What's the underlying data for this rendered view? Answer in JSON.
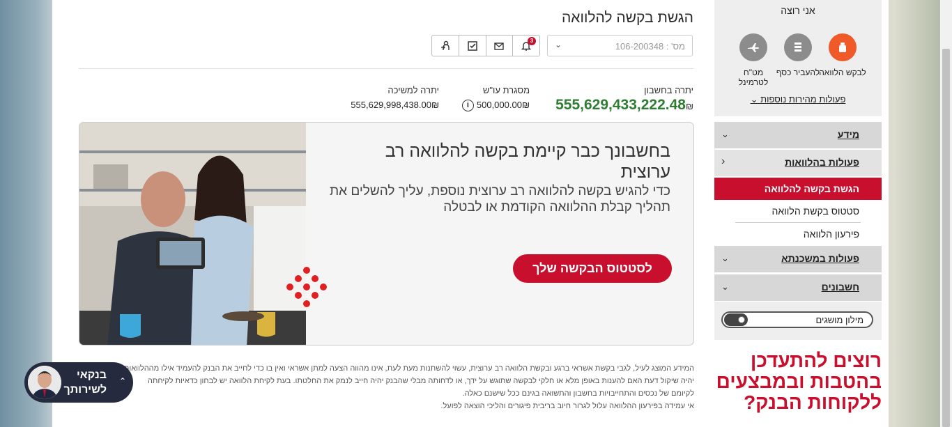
{
  "page": {
    "title": "הגשת בקשה להלוואה",
    "account_select": {
      "value": "מס' : 106-200348"
    },
    "notifications_count": "3"
  },
  "balances": {
    "account": {
      "label": "יתרה בחשבון",
      "value": "555,629,433,222.48",
      "currency": "₪"
    },
    "credit": {
      "label": "מסגרת עו\"ש",
      "value": "500,000.00",
      "currency": "₪",
      "info": "i"
    },
    "withdraw": {
      "label": "יתרה למשיכה",
      "value": "555,629,998,438.00",
      "currency": "₪"
    }
  },
  "card": {
    "heading": "בחשבונך כבר קיימת בקשה להלוואה רב ערוצית",
    "body": "כדי להגיש בקשה להלוואה רב ערוצית נוספת, עליך להשלים את תהליך קבלת ההלוואה הקודמת או לבטלה",
    "cta": "לסטטוס הבקשה שלך"
  },
  "disclaimer": [
    "המידע המוצג לעיל, לגבי בקשת אשראי ברגע ובקשת הלוואה רב ערוצית, עשוי להשתנות מעת לעת, אינו מהווה הצעה למתן אשראי ואין בו כדי לחייב את הבנק להעמיד אילו מההלוואות",
    "יהיה שיקול דעת האם להענות באופן מלא או חלקי לבקשה שתוגש על ידך, או לדחותה מבלי שהבנק יהיה חייב לנמק את החלטתו. בעת לקיחת הלוואה יש לבחון כדאיות לקיחתה",
    "לקיומם של נכסים והתחייבויות בחשבון והתשואה בגינם ככל שישנם כאלה.",
    "אי עמידה בפירעון ההלוואה עלול לגרור חיוב בריבית פיגורים והליכי הוצאה לפועל."
  ],
  "chat": {
    "line1": "בנקאי",
    "line2": "לשירותך"
  },
  "sidebar": {
    "quick_title": "אני רוצה",
    "quick_actions": [
      {
        "label": "לבקש הלוואה",
        "icon": "money-bag-icon",
        "color": "#f05a28"
      },
      {
        "label": "להעביר כסף",
        "icon": "stack-icon",
        "color": "#8c8c8c"
      },
      {
        "label": "מט\"ח לטרמינל",
        "icon": "plane-icon",
        "color": "#8c8c8c"
      }
    ],
    "more_actions": "פעולות מהירות נוספות",
    "nav": {
      "info": "מידע",
      "loan_actions": "פעולות בהלוואות",
      "loan_sub": [
        "הגשת בקשה להלוואה",
        "סטטוס בקשת הלוואה",
        "פירעון הלוואה"
      ],
      "mortgage": "פעולות במשכנתא",
      "accounts": "חשבונים"
    },
    "glossary": "מילון מושגים",
    "promo": "רוצים להתעדכן בהטבות ובמבצעים ללקוחות הבנק?"
  },
  "colors": {
    "brand_red": "#c8102e",
    "balance_green": "#2e7d32",
    "accent_orange": "#f05a28"
  }
}
